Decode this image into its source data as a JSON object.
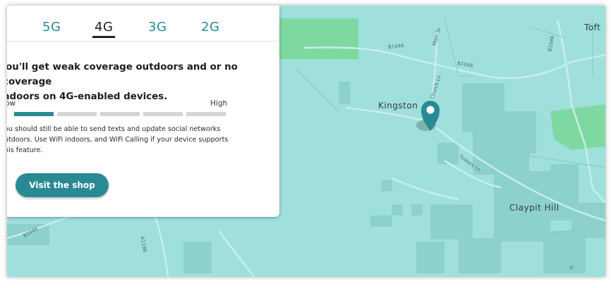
{
  "tabs": [
    {
      "label": "5G",
      "active": false
    },
    {
      "label": "4G",
      "active": true
    },
    {
      "label": "3G",
      "active": false
    },
    {
      "label": "2G",
      "active": false
    }
  ],
  "coverage": {
    "headline_line1": "'ou'll get weak coverage outdoors and or no coverage",
    "headline_line2": "ndoors on 4G-enabled devices.",
    "scale_low": "ow",
    "scale_high": "High",
    "level_filled": 1,
    "level_total": 5,
    "description_line1": "ou should still be able to send texts and update social networks",
    "description_line2": "utdoors. Use WiFi indoors, and WiFi Calling if your device supports",
    "description_line3": "his feature.",
    "button_label": "Visit the shop"
  },
  "map": {
    "places": {
      "kingston": "Kingston",
      "claypit": "Claypit Hill",
      "toft": "Toft"
    },
    "roads": {
      "b1046_a": "B1046",
      "b1046_b": "B1046",
      "b1046_c": "B1046",
      "b1046_d": "B1046",
      "main_st": "Main St",
      "church_ln": "Church Ln",
      "tinkers_ln": "Tinkers Ln",
      "a1198": "A1198",
      "hb": "H"
    }
  },
  "colors": {
    "accent": "#2a8a93",
    "coverage_weak": "#9fe0dc",
    "coverage_mid": "#8dd1cd",
    "coverage_good": "#7ed9a0"
  }
}
